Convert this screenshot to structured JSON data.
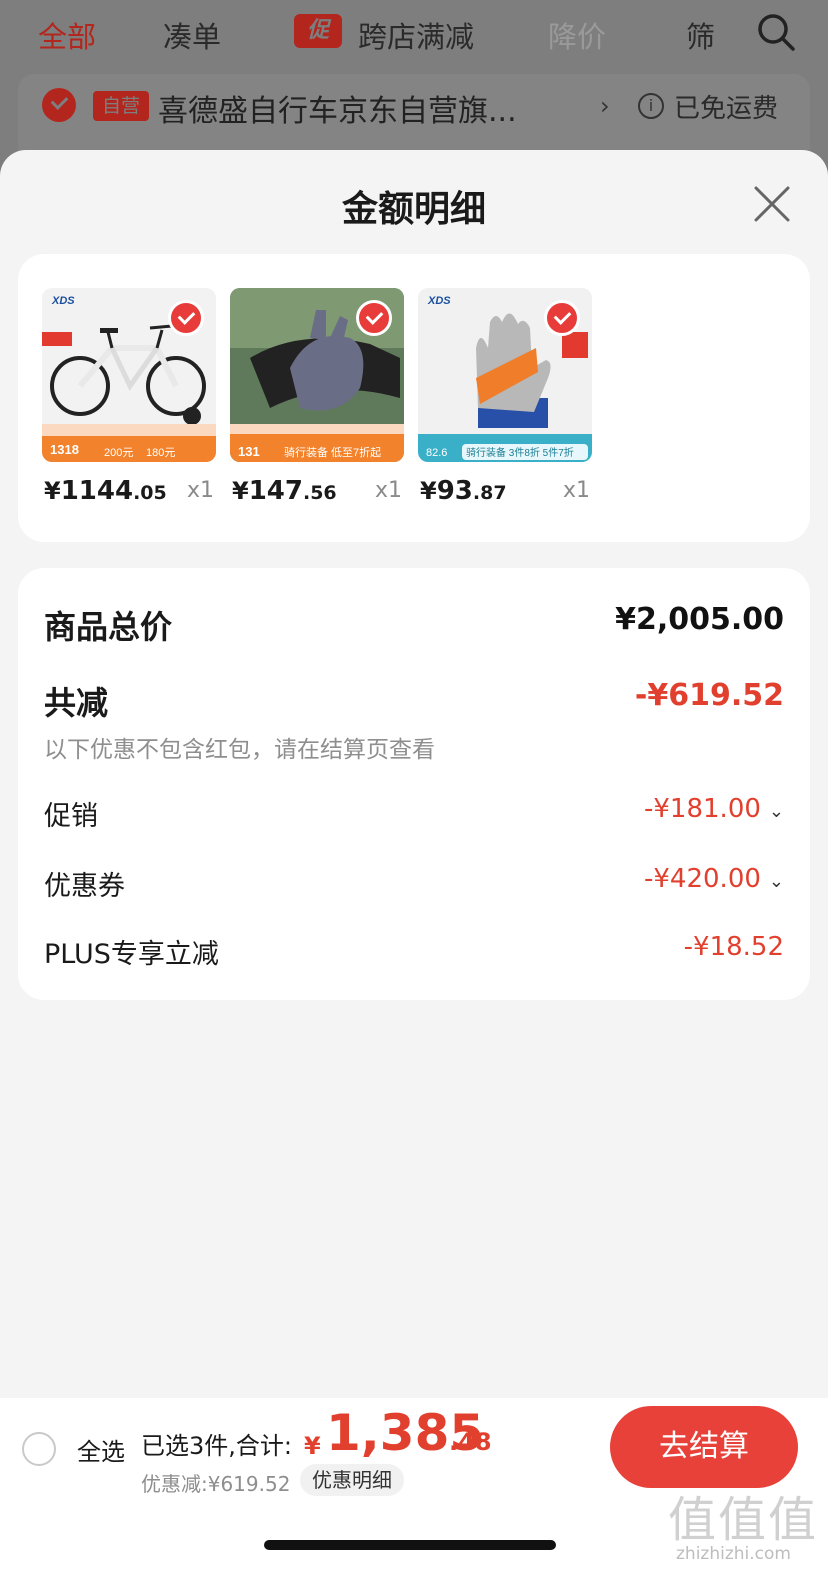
{
  "background": {
    "tabs": [
      "全部",
      "凑单",
      "跨店满减",
      "降价",
      "筛"
    ],
    "promo_badge": "促",
    "store": {
      "badge": "自营",
      "name": "喜德盛自行车京东自营旗...",
      "shipping": "已免运费"
    }
  },
  "sheet": {
    "title": "金额明细",
    "products": [
      {
        "name": "bike",
        "price_int": "1144",
        "price_dec": ".05",
        "qty": "x1",
        "img_text": "XDS",
        "img_price": "1318",
        "img_tag1": "200元",
        "img_tag2": "180元"
      },
      {
        "name": "gloves",
        "price_int": "147",
        "price_dec": ".56",
        "qty": "x1",
        "img_text": "",
        "img_price": "131",
        "img_tag1": "骑行装备 低至7折起",
        "img_tag2": ""
      },
      {
        "name": "gloves-orange",
        "price_int": "93",
        "price_dec": ".87",
        "qty": "x1",
        "img_text": "XDS",
        "img_price": "82.6",
        "img_tag1": "骑行装备 3件8折 5件7折",
        "img_tag2": ""
      }
    ],
    "currency": "¥",
    "amounts": {
      "total_label": "商品总价",
      "total_value": "¥2,005.00",
      "reduce_label": "共减",
      "reduce_value": "-¥619.52",
      "note": "以下优惠不包含红包，请在结算页查看",
      "promo_label": "促销",
      "promo_value": "-¥181.00",
      "coupon_label": "优惠券",
      "coupon_value": "-¥420.00",
      "plus_label": "PLUS专享立减",
      "plus_value": "-¥18.52"
    }
  },
  "bottom": {
    "select_all": "全选",
    "selected_text": "已选3件,合计:",
    "total_yen": "¥",
    "total_int": "1,385",
    "total_dec": ".48",
    "discount": "优惠减:¥619.52",
    "detail_chip": "优惠明细",
    "checkout": "去结算"
  },
  "watermark": {
    "text": "值值值",
    "url": "zhizhizhi.com"
  },
  "colors": {
    "accent": "#e8413a",
    "price_red": "#e2402e",
    "sheet_bg": "#f4f4f4"
  }
}
